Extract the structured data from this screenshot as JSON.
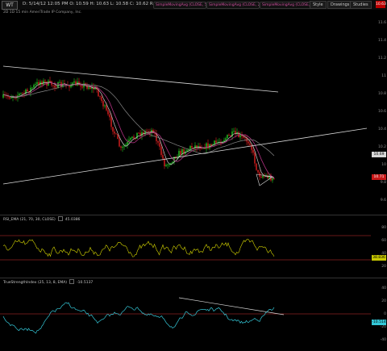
{
  "toolbar": {
    "symbol": "WT",
    "ohlc": "D: 5/14/12 12:05 PM  O: 10.59  H: 10.63  L: 10.58  C: 10.62  R: 0.04",
    "study1": "SimpleMovingAvg (CLOSE, 50, 0, no)",
    "study2": "SimpleMovingAvg (CLOSE, 200, 0, no)",
    "study3": "SimpleMovingAvg (CLOSE, 20, 0, no)",
    "buttons": [
      "Style",
      "Drawings",
      "Studies"
    ],
    "red_value": "10.63"
  },
  "subtitle": "2D 1D 15 min AmeriTrade IP Company, Inc.",
  "price_axis": {
    "ticks": [
      "11.6",
      "11.4",
      "11.2",
      "11",
      "10.8",
      "10.6",
      "10.4",
      "10.2",
      "10",
      "9.8",
      "9.6"
    ],
    "last_badge": "10.69",
    "current_badge": "10.71"
  },
  "rsi": {
    "title": "RSI_EMA (21, 70, 30, CLOSE)",
    "value": "45.0386",
    "ticks": [
      "80",
      "60",
      "40",
      "20"
    ],
    "badge": "38.836",
    "colors": {
      "line": "#d6d600",
      "levels": "#d23030"
    }
  },
  "tsi": {
    "title": "TrueStrengthIndex (25, 13, 8, EMA)",
    "value": "-10.5137",
    "ticks": [
      "40",
      "20",
      "0",
      "-20",
      "-40"
    ],
    "badge": "-10.514",
    "colors": {
      "line": "#34c8d8",
      "zero": "#d23030"
    }
  },
  "colors": {
    "up_candle": "#22cc22",
    "down_candle": "#e02020",
    "ma_fast": "#c8c8c8",
    "ma_mid": "#b03080",
    "ma_slow": "#888888",
    "trendline": "#d8d8d8"
  }
}
